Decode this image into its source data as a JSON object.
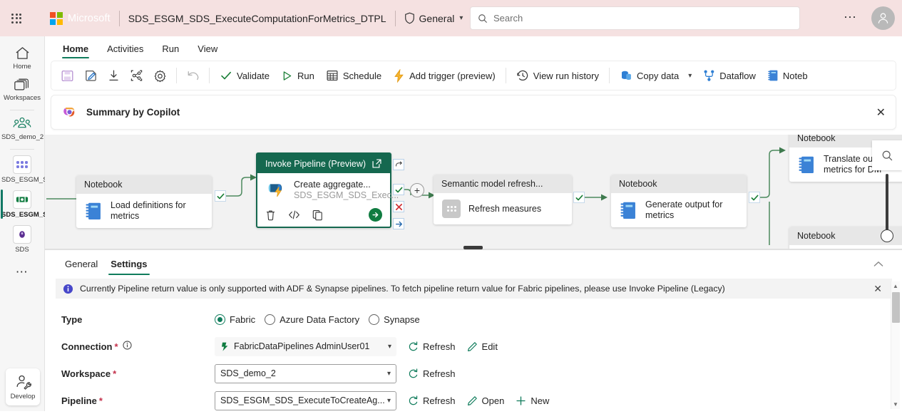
{
  "topbar": {
    "waffle_icon": "waffle-grid-icon",
    "brand": "Microsoft",
    "document_title": "SDS_ESGM_SDS_ExecuteComputationForMetrics_DTPL",
    "workspace_chip": "General",
    "shield_icon": "shield-icon",
    "chevron_icon": "chevron-down-icon",
    "search": {
      "placeholder": "Search",
      "value": "",
      "icon": "search-icon"
    },
    "more_icon": "ellipsis-icon",
    "account_icon": "account-avatar-icon"
  },
  "rail": {
    "items": [
      {
        "label": "Home",
        "icon": "home-icon",
        "selected": false
      },
      {
        "label": "Workspaces",
        "icon": "workspaces-icon",
        "selected": false
      },
      {
        "label": "SDS_demo_2",
        "icon": "people-group-icon",
        "selected": false
      },
      {
        "label": "SDS_ESGM_SDS_Datas...",
        "icon": "semantic-model-icon",
        "selected": false
      },
      {
        "label": "SDS_ESGM_SDS_Exec...",
        "icon": "pipeline-icon",
        "selected": true
      },
      {
        "label": "SDS",
        "icon": "purple-diamond-icon",
        "selected": false
      }
    ],
    "more_icon": "ellipsis-icon",
    "develop": {
      "label": "Develop",
      "icon": "develop-person-wrench-icon"
    }
  },
  "ribbon": {
    "tabs": [
      {
        "label": "Home",
        "active": true
      },
      {
        "label": "Activities",
        "active": false
      },
      {
        "label": "Run",
        "active": false
      },
      {
        "label": "View",
        "active": false
      }
    ],
    "commands": [
      {
        "label": "",
        "icon": "save-icon",
        "type": "icon"
      },
      {
        "label": "",
        "icon": "save-as-icon",
        "type": "icon"
      },
      {
        "label": "",
        "icon": "download-icon",
        "type": "icon"
      },
      {
        "label": "",
        "icon": "share-nodes-icon",
        "type": "icon"
      },
      {
        "label": "",
        "icon": "gear-icon",
        "type": "icon"
      },
      {
        "label": "",
        "icon": "undo-icon",
        "type": "icon",
        "disabled": true
      },
      {
        "label": "Validate",
        "icon": "checkmark-icon",
        "type": "text"
      },
      {
        "label": "Run",
        "icon": "play-triangle-icon",
        "type": "text"
      },
      {
        "label": "Schedule",
        "icon": "calendar-grid-icon",
        "type": "text"
      },
      {
        "label": "Add trigger (preview)",
        "icon": "lightning-bolt-icon",
        "type": "text"
      },
      {
        "label": "View run history",
        "icon": "clock-history-icon",
        "type": "text"
      },
      {
        "label": "Copy data",
        "icon": "copy-data-icon",
        "type": "text",
        "chevron": true
      },
      {
        "label": "Dataflow",
        "icon": "dataflow-icon",
        "type": "text"
      },
      {
        "label": "Noteb",
        "icon": "notebook-icon",
        "type": "text"
      }
    ]
  },
  "copilot": {
    "title": "Summary by Copilot",
    "icon": "copilot-icon",
    "close_icon": "close-icon"
  },
  "canvas": {
    "nodes": [
      {
        "header": "Notebook",
        "title": "Load definitions for metrics",
        "icon": "notebook-icon"
      },
      {
        "header": "Invoke Pipeline (Preview)",
        "title": "Create aggregate...",
        "subtitle": "SDS_ESGM_SDS_Exec...",
        "icon": "invoke-pipeline-icon",
        "selected": true,
        "actions": [
          "delete-icon",
          "code-icon",
          "clone-icon",
          "run-arrow-icon"
        ],
        "open_icon": "open-external-icon"
      },
      {
        "header": "Semantic model refresh...",
        "title": "Refresh measures",
        "icon": "semantic-model-refresh-icon"
      },
      {
        "header": "Notebook",
        "title": "Generate output for metrics",
        "icon": "notebook-icon"
      },
      {
        "header": "Notebook",
        "title": "Translate output metrics for DM",
        "icon": "notebook-icon"
      },
      {
        "header": "Notebook",
        "title": "",
        "icon": "notebook-icon"
      }
    ],
    "ports": [
      "on-skip-icon",
      "on-success-icon",
      "on-fail-icon",
      "on-completion-icon"
    ],
    "add_node_icon": "plus-icon",
    "zoom_icon": "zoom-search-icon",
    "drag_handle": "panel-resize-handle"
  },
  "panel": {
    "tabs": [
      {
        "label": "General",
        "active": false
      },
      {
        "label": "Settings",
        "active": true
      }
    ],
    "collapse_icon": "chevron-up-icon",
    "info": {
      "icon": "info-icon",
      "message": "Currently Pipeline return value is only supported with ADF & Synapse pipelines. To fetch pipeline return value for Fabric pipelines, please use Invoke Pipeline (Legacy)",
      "close_icon": "close-icon"
    },
    "fields": {
      "type": {
        "label": "Type",
        "options": [
          {
            "label": "Fabric",
            "selected": true
          },
          {
            "label": "Azure Data Factory",
            "selected": false
          },
          {
            "label": "Synapse",
            "selected": false
          }
        ]
      },
      "connection": {
        "label": "Connection",
        "required": true,
        "info_icon": "info-icon",
        "value": "FabricDataPipelines AdminUser01",
        "value_icon": "connection-icon",
        "actions": [
          {
            "label": "Refresh",
            "icon": "refresh-icon"
          },
          {
            "label": "Edit",
            "icon": "pencil-icon"
          }
        ]
      },
      "workspace": {
        "label": "Workspace",
        "required": true,
        "value": "SDS_demo_2",
        "actions": [
          {
            "label": "Refresh",
            "icon": "refresh-icon"
          }
        ]
      },
      "pipeline": {
        "label": "Pipeline",
        "required": true,
        "value": "SDS_ESGM_SDS_ExecuteToCreateAg...",
        "actions": [
          {
            "label": "Refresh",
            "icon": "refresh-icon"
          },
          {
            "label": "Open",
            "icon": "pencil-icon"
          },
          {
            "label": "New",
            "icon": "plus-icon"
          }
        ]
      }
    },
    "scrollbar": {
      "up_icon": "caret-up-icon",
      "down_icon": "caret-down-icon"
    }
  },
  "colors": {
    "topbar_bg": "#f5e1e1",
    "accent_green": "#107c5c",
    "selected_node_header": "#15684f",
    "required_red": "#c4314b",
    "canvas_bg": "#f2f2f2"
  }
}
